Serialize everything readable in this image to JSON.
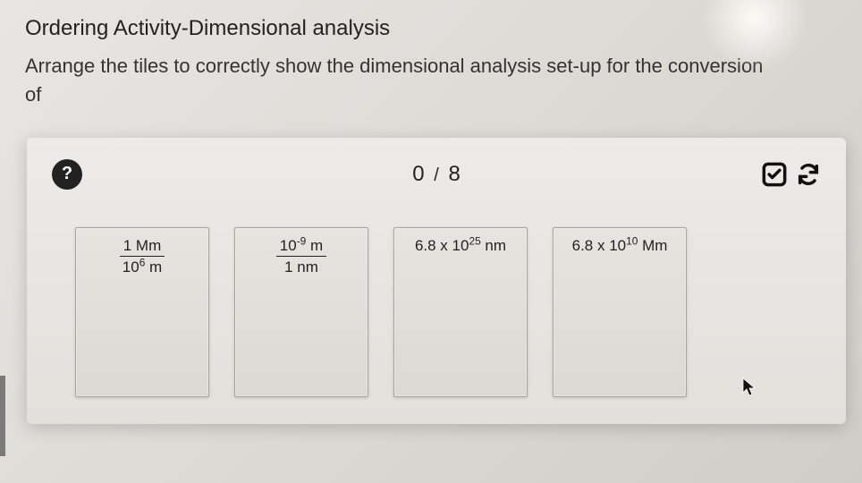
{
  "header": {
    "title": "Ordering Activity-Dimensional analysis",
    "instructions_line1": "Arrange the tiles to correctly show the dimensional analysis set-up for the conversion",
    "instructions_line2": "of"
  },
  "toolbar": {
    "help_symbol": "?",
    "score_current": "0",
    "score_separator": "/",
    "score_total": "8"
  },
  "tiles": [
    {
      "type": "fraction",
      "top": "1 Mm",
      "bottom_base": "10",
      "bottom_exp": "6",
      "bottom_unit": " m"
    },
    {
      "type": "fraction",
      "top_base": "10",
      "top_exp": "-9",
      "top_unit": " m",
      "bottom": "1 nm"
    },
    {
      "type": "value",
      "base": "6.8 x 10",
      "exp": "25",
      "unit": " nm"
    },
    {
      "type": "value",
      "base": "6.8 x 10",
      "exp": "10",
      "unit": " Mm"
    }
  ]
}
